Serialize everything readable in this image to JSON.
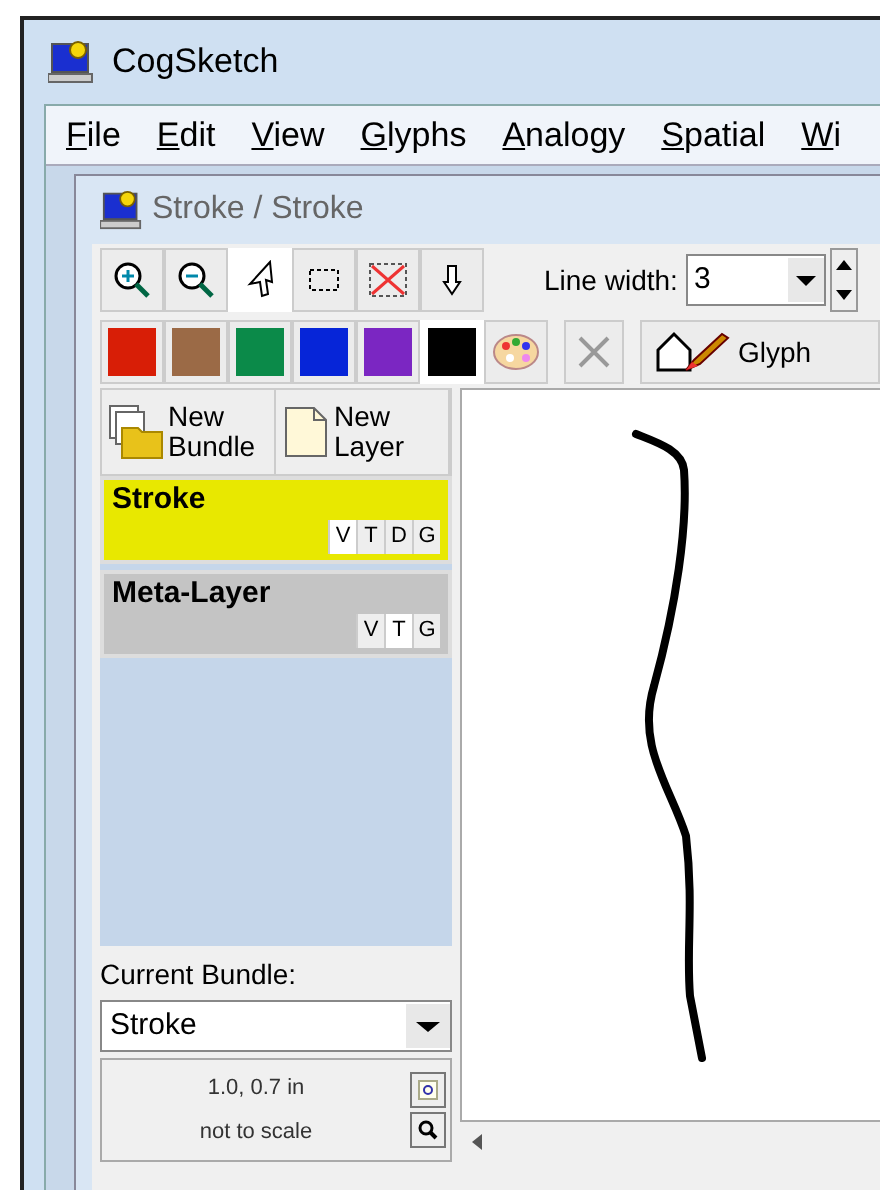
{
  "window": {
    "title": "CogSketch"
  },
  "menu": [
    "File",
    "Edit",
    "View",
    "Glyphs",
    "Analogy",
    "Spatial",
    "Wi"
  ],
  "sketch_window": {
    "title": "Stroke / Stroke"
  },
  "tools": [
    {
      "kind": "zoom-in",
      "selected": false
    },
    {
      "kind": "zoom-out",
      "selected": false
    },
    {
      "kind": "pointer",
      "selected": true
    },
    {
      "kind": "select-box",
      "selected": false
    },
    {
      "kind": "erase-box",
      "selected": false
    },
    {
      "kind": "down-arrow",
      "selected": false
    }
  ],
  "line_width": {
    "label": "Line width:",
    "value": "3"
  },
  "colors": [
    {
      "color": "#d81e06",
      "selected": false
    },
    {
      "color": "#9b6a46",
      "selected": false
    },
    {
      "color": "#0b8a49",
      "selected": false
    },
    {
      "color": "#0625d8",
      "selected": false
    },
    {
      "color": "#7b26c2",
      "selected": false
    },
    {
      "color": "#000000",
      "selected": true
    }
  ],
  "glyph_button": "Glyph",
  "panel_buttons": [
    {
      "kind": "bundle",
      "label": "New\nBundle"
    },
    {
      "kind": "layer",
      "label": "New\nLayer"
    }
  ],
  "layers": [
    {
      "name": "Stroke",
      "selected": true,
      "toggles": [
        {
          "label": "V",
          "on": true
        },
        {
          "label": "T",
          "on": false
        },
        {
          "label": "D",
          "on": false
        },
        {
          "label": "G",
          "on": false
        }
      ]
    },
    {
      "name": "Meta-Layer",
      "selected": false,
      "toggles": [
        {
          "label": "V",
          "on": false
        },
        {
          "label": "T",
          "on": true
        },
        {
          "label": "G",
          "on": false
        }
      ]
    }
  ],
  "current_bundle": {
    "label": "Current Bundle:",
    "value": "Stroke"
  },
  "status": {
    "size": "1.0, 0.7 in",
    "scale": "not to scale"
  }
}
